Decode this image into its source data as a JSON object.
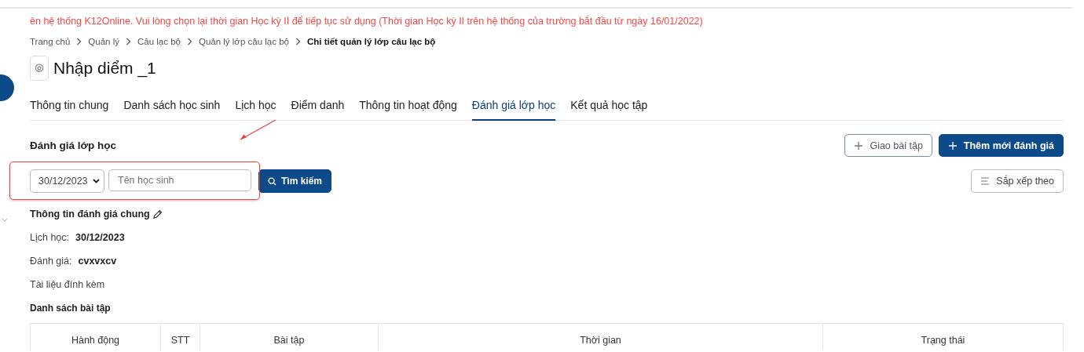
{
  "notice": "ên hệ thống K12Online. Vui lòng chọn lại thời gian Học kỳ II để tiếp tục sử dụng (Thời gian Học kỳ II trên hệ thống của trường bắt đầu từ ngày 16/01/2022)",
  "breadcrumb": [
    {
      "label": "Trang chủ",
      "current": false
    },
    {
      "label": "Quản lý",
      "current": false
    },
    {
      "label": "Câu lạc bộ",
      "current": false
    },
    {
      "label": "Quản lý lớp câu lạc bộ",
      "current": false
    },
    {
      "label": "Chi tiết quản lý lớp câu lạc bộ",
      "current": true
    }
  ],
  "page_title": "Nhập diểm _1",
  "tabs": [
    {
      "label": "Thông tin chung",
      "selected": false
    },
    {
      "label": "Danh sách học sinh",
      "selected": false
    },
    {
      "label": "Lịch học",
      "selected": false
    },
    {
      "label": "Điểm danh",
      "selected": false
    },
    {
      "label": "Thông tin hoạt động",
      "selected": false
    },
    {
      "label": "Đánh giá lớp học",
      "selected": true
    },
    {
      "label": "Kết quả học tập",
      "selected": false
    }
  ],
  "section_title": "Đánh giá lớp học",
  "buttons": [
    {
      "label": "Giao bài tập",
      "kind": "outline"
    },
    {
      "label": "Thêm mới đánh giá",
      "kind": "primary"
    }
  ],
  "filters": {
    "date": "30/12/2023",
    "search": {
      "placeholder": "Tên học sinh"
    },
    "search_button": "Tìm kiếm"
  },
  "sort_button": "Sắp xếp theo",
  "info": {
    "heading": "Thông tin đánh giá chung",
    "fields": [
      {
        "label": "Lịch học:",
        "value": "30/12/2023"
      },
      {
        "label": "Đánh giá:",
        "value": "cvxvxcv"
      }
    ],
    "attachments": "Tài liệu đính kèm"
  },
  "exercises": {
    "title": "Danh sách bài tập",
    "columns": [
      "Hành động",
      "STT",
      "Bài tập",
      "Thời gian",
      "Trạng thái"
    ]
  }
}
